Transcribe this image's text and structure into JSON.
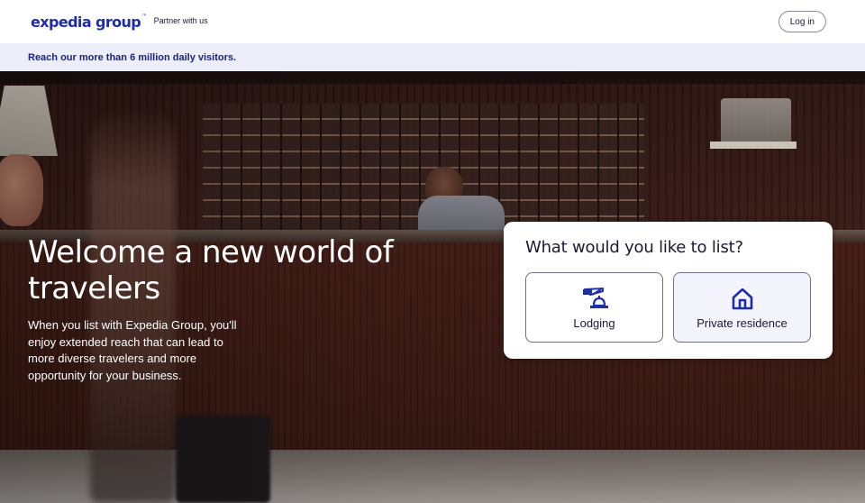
{
  "header": {
    "logo_text": "expedia group",
    "logo_mark": "™",
    "partner_text": "Partner with us",
    "login_label": "Log in"
  },
  "banner": {
    "text": "Reach our more than 6 million daily visitors."
  },
  "hero": {
    "title": "Welcome a new world of travelers",
    "description": "When you list with Expedia Group, you'll enjoy extended reach that can lead to more diverse travelers and more opportunity for your business."
  },
  "listing_card": {
    "title": "What would you like to list?",
    "options": [
      {
        "label": "Lodging",
        "icon": "reception-bell-icon"
      },
      {
        "label": "Private residence",
        "icon": "house-icon"
      }
    ]
  },
  "colors": {
    "brand": "#1d2ea8",
    "banner_bg": "#eceefa",
    "banner_text": "#1b237f"
  }
}
